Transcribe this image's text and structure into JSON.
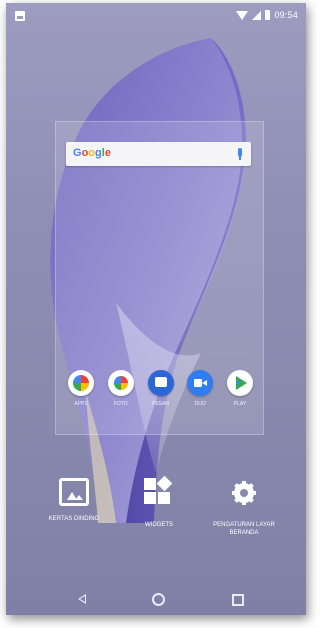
{
  "status_bar": {
    "time": "09:54",
    "icons": [
      "gallery-notification-icon",
      "wifi-icon",
      "signal-icon",
      "battery-icon"
    ]
  },
  "search_widget": {
    "logo_letters": [
      "G",
      "o",
      "o",
      "g",
      "l",
      "e"
    ],
    "icon": "mic-icon"
  },
  "dock_apps": [
    {
      "label": "APPS",
      "icon": "apps-icon"
    },
    {
      "label": "FOTO",
      "icon": "photos-icon"
    },
    {
      "label": "PESAN",
      "icon": "messages-icon"
    },
    {
      "label": "DUO",
      "icon": "duo-icon"
    },
    {
      "label": "PLAY",
      "icon": "play-store-icon"
    }
  ],
  "home_actions": [
    {
      "label": "KERTAS DINDING",
      "icon": "wallpaper-icon"
    },
    {
      "label": "WIDGETS",
      "icon": "widgets-icon"
    },
    {
      "label": "PENGATURAN LAYAR BERANDA",
      "icon": "gear-icon"
    }
  ],
  "nav_bar": {
    "icons": [
      "back-icon",
      "home-icon",
      "recents-icon"
    ]
  },
  "colors": {
    "background": "#8f8fb6",
    "ribbon_dark": "#5a4fb0",
    "ribbon_light": "#c8c2e6",
    "accent_blue": "#4285f4"
  }
}
